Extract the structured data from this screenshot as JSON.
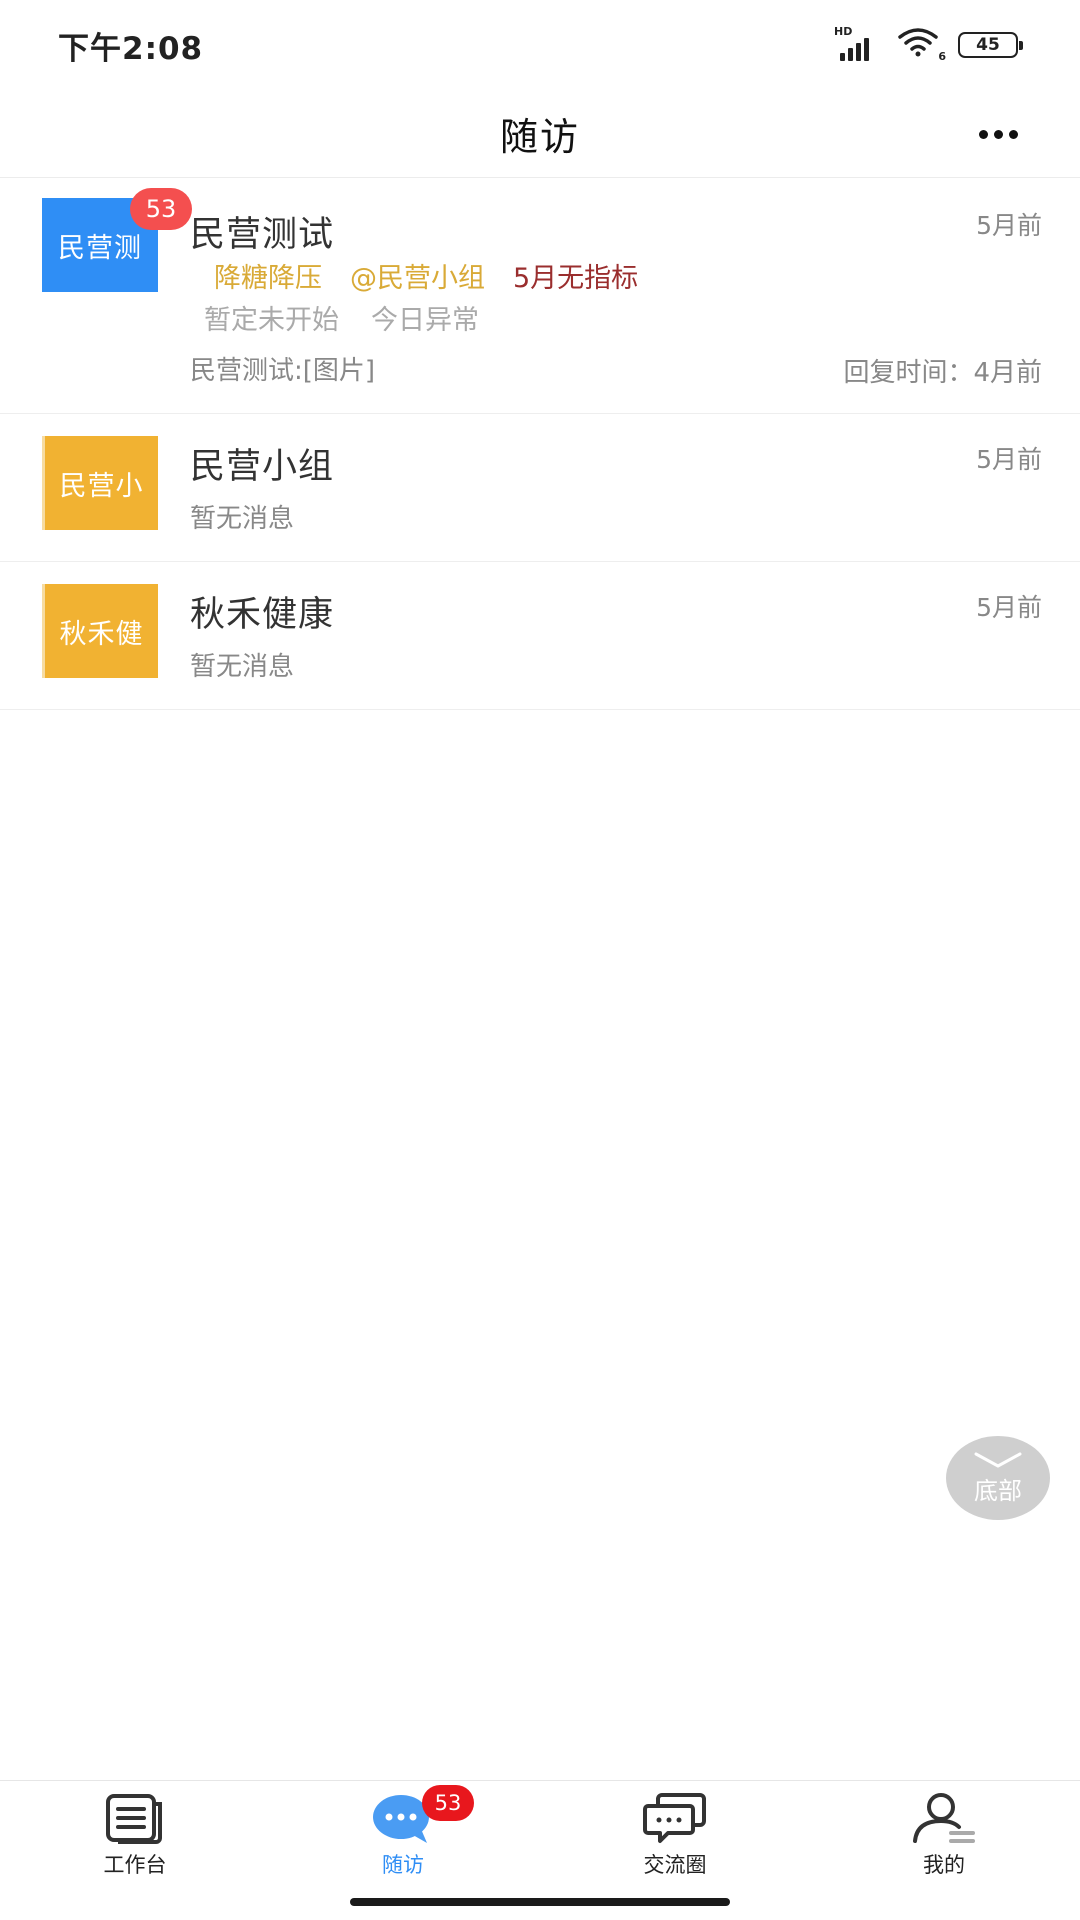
{
  "status_bar": {
    "time": "下午2:08",
    "hd": "HD",
    "network": "6",
    "battery": "45"
  },
  "header": {
    "title": "随访"
  },
  "conversations": [
    {
      "avatar_text": "民营测",
      "avatar_color": "#2f8ef5",
      "badge": "53",
      "name": "民营测试",
      "time": "5月前",
      "tags": [
        "降糖降压",
        "@民营小组",
        "5月无指标"
      ],
      "statuses": [
        "暂定未开始",
        "今日异常"
      ],
      "last_message": "民营测试:[图片]",
      "reply_time": "回复时间：4月前"
    },
    {
      "avatar_text": "民营小",
      "avatar_color": "#f1b232",
      "name": "民营小组",
      "time": "5月前",
      "last_message": "暂无消息"
    },
    {
      "avatar_text": "秋禾健",
      "avatar_color": "#f1b232",
      "name": "秋禾健康",
      "time": "5月前",
      "last_message": "暂无消息"
    }
  ],
  "floating": {
    "to_bottom": "底部"
  },
  "tabs": [
    {
      "label": "工作台",
      "icon": "document-icon"
    },
    {
      "label": "随访",
      "icon": "chat-bubble-icon",
      "badge": "53",
      "active": true
    },
    {
      "label": "交流圈",
      "icon": "chat-group-icon"
    },
    {
      "label": "我的",
      "icon": "user-icon"
    }
  ],
  "colors": {
    "accent": "#2f8ef5",
    "badge": "#f44f4f",
    "tag_yellow": "#d9aa37",
    "tag_red": "#9a2e2e"
  }
}
